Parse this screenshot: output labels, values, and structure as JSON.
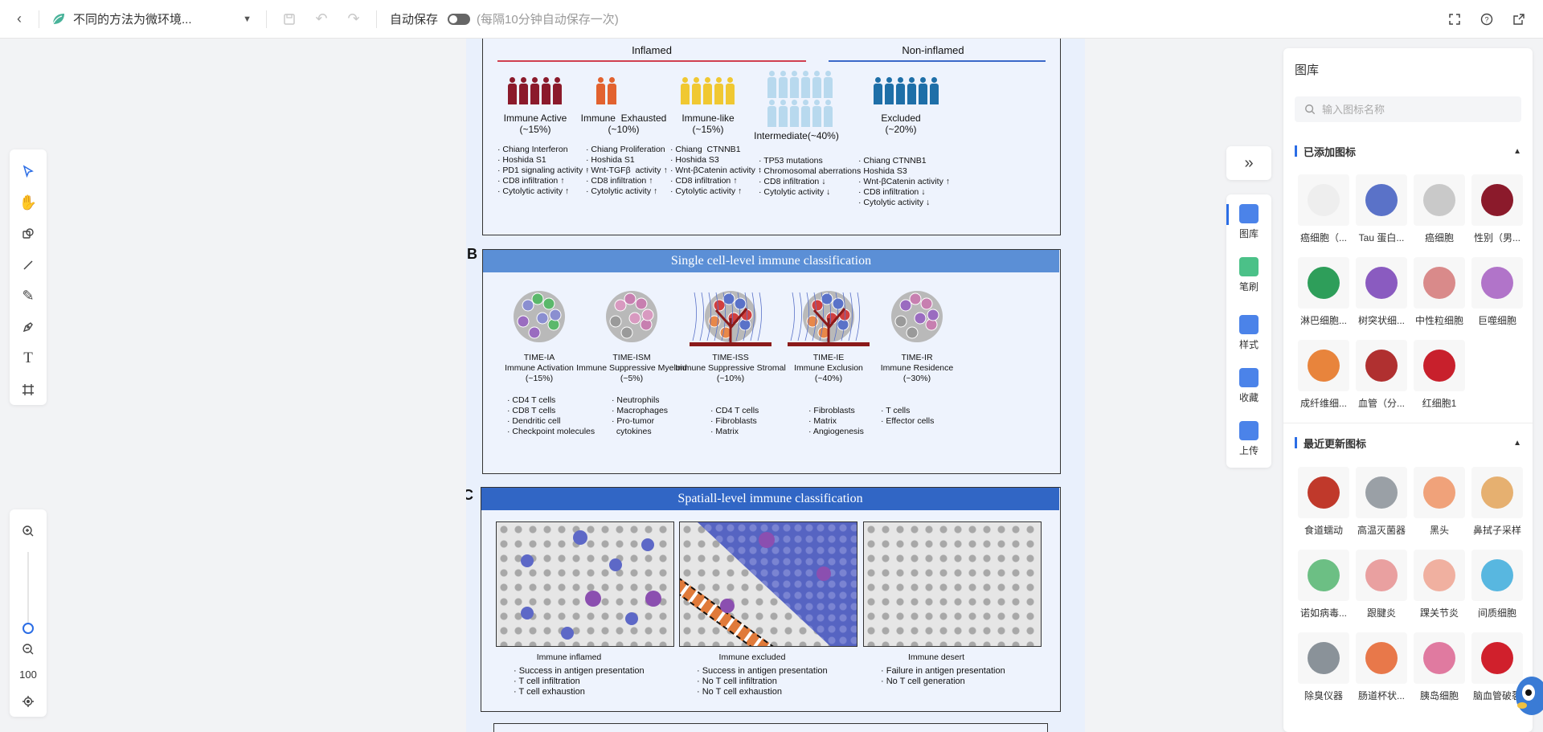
{
  "topbar": {
    "back_icon": "chevron-left-icon",
    "title": "不同的方法为微环境...",
    "autosave_label": "自动保存",
    "autosave_note": "(每隔10分钟自动保存一次)",
    "autosave_enabled": false
  },
  "zoom": {
    "value": "100"
  },
  "figure": {
    "panelA": {
      "inflamed_label": "Inflamed",
      "noninflamed_label": "Non-inflamed",
      "groups": [
        {
          "name": "Immune Active",
          "pct": "(~15%)",
          "color": "#8b1a2b",
          "count": 5,
          "bullets": "· Chiang Interferon\n· Hoshida S1\n· PD1 signaling activity ↑\n· CD8 infiltration ↑\n· Cytolytic activity ↑"
        },
        {
          "name": "Immune  Exhausted",
          "pct": "(~10%)",
          "color": "#e2622f",
          "count": 2,
          "bullets": "· Chiang Proliferation\n· Hoshida S1\n· Wnt-TGFβ  activity ↑\n· CD8 infiltration ↑\n· Cytolytic activity ↑"
        },
        {
          "name": "Immune-like",
          "pct": "(~15%)",
          "color": "#f0c832",
          "count": 5,
          "bullets": "· Chiang  CTNNB1\n· Hoshida S3\n· Wnt-βCatenin activity ↑\n· CD8 infiltration ↑\n· Cytolytic activity ↑"
        },
        {
          "name": "Intermediate(~40%)",
          "pct": "",
          "color": "#b8d9ee",
          "count": 6,
          "bullets": "· TP53 mutations\n· Chromosomal aberrations\n· CD8 infiltration ↓\n· Cytolytic activity ↓"
        },
        {
          "name": "Excluded",
          "pct": "(~20%)",
          "color": "#1e6fa8",
          "count": 6,
          "bullets": "· Chiang CTNNB1\n· Hoshida S3\n· Wnt-βCatenin activity ↑\n· CD8 infiltration ↓\n· Cytolytic activity ↓"
        }
      ]
    },
    "panelB": {
      "letter": "B",
      "title": "Single cell-level immune classification",
      "types": [
        {
          "code": "TIME-IA",
          "name": "Immune Activation",
          "pct": "(~15%)",
          "bullets": "· CD4 T cells\n· CD8 T cells\n· Dendritic cell\n· Checkpoint molecules"
        },
        {
          "code": "TIME-ISM",
          "name": "Immune Suppressive Myeloid",
          "pct": "(~5%)",
          "bullets": "· Neutrophils\n· Macrophages\n· Pro-tumor\n  cytokines"
        },
        {
          "code": "TIME-ISS",
          "name": "Immune Suppressive Stromal",
          "pct": "(~10%)",
          "bullets": "· CD4 T cells\n· Fibroblasts\n· Matrix"
        },
        {
          "code": "TIME-IE",
          "name": "Immune Exclusion",
          "pct": "(~40%)",
          "bullets": "· Fibroblasts\n· Matrix\n· Angiogenesis"
        },
        {
          "code": "TIME-IR",
          "name": "Immune Residence",
          "pct": "(~30%)",
          "bullets": "· T cells\n· Effector cells"
        }
      ]
    },
    "panelC": {
      "letter": "C",
      "title": "Spatiall-level immune classification",
      "types": [
        {
          "name": "Immune inflamed",
          "bullets": "· Success in antigen presentation\n· T cell infiltration\n· T cell exhaustion"
        },
        {
          "name": "Immune excluded",
          "bullets": "· Success in antigen presentation\n· No T cell infiltration\n· No T cell exhaustion"
        },
        {
          "name": "Immune desert",
          "bullets": "· Failure in antigen presentation\n· No T cell generation"
        }
      ]
    }
  },
  "right_tabs": [
    {
      "label": "图库",
      "icon": "gallery-icon",
      "color": "#2b6de5"
    },
    {
      "label": "笔刷",
      "icon": "brush-icon",
      "color": "#2bb673"
    },
    {
      "label": "样式",
      "icon": "style-icon",
      "color": "#2b6de5"
    },
    {
      "label": "收藏",
      "icon": "favorite-icon",
      "color": "#2b6de5"
    },
    {
      "label": "上传",
      "icon": "upload-icon",
      "color": "#2b6de5"
    }
  ],
  "library": {
    "title": "图库",
    "search_placeholder": "输入图标名称",
    "added_title": "已添加图标",
    "added": [
      {
        "label": "癌细胞（...",
        "color": "#eeeeee"
      },
      {
        "label": "Tau 蛋白...",
        "color": "#5a72c8"
      },
      {
        "label": "癌细胞",
        "color": "#c9c9c9"
      },
      {
        "label": "性别（男...",
        "color": "#8b1a2b"
      },
      {
        "label": "淋巴细胞...",
        "color": "#2e9e5a"
      },
      {
        "label": "树突状细...",
        "color": "#8a5bc0"
      },
      {
        "label": "中性粒细胞",
        "color": "#d98a8a"
      },
      {
        "label": "巨噬细胞",
        "color": "#b174c9"
      },
      {
        "label": "成纤维细...",
        "color": "#e8843c"
      },
      {
        "label": "血管（分...",
        "color": "#b03030"
      },
      {
        "label": "红细胞1",
        "color": "#c8202c"
      }
    ],
    "recent_title": "最近更新图标",
    "recent": [
      {
        "label": "食道蠕动",
        "color": "#c0392b"
      },
      {
        "label": "高温灭菌器",
        "color": "#9aa0a6"
      },
      {
        "label": "黑头",
        "color": "#f0a27a"
      },
      {
        "label": "鼻拭子采样",
        "color": "#e6b070"
      },
      {
        "label": "诺如病毒...",
        "color": "#6cbf84"
      },
      {
        "label": "跟腱炎",
        "color": "#e9a0a0"
      },
      {
        "label": "踝关节炎",
        "color": "#f0b0a0"
      },
      {
        "label": "间质细胞",
        "color": "#58b7e0"
      },
      {
        "label": "除臭仪器",
        "color": "#8a9299"
      },
      {
        "label": "肠道杯状...",
        "color": "#e8784a"
      },
      {
        "label": "胰岛细胞",
        "color": "#e07aa0"
      },
      {
        "label": "脑血管破裂",
        "color": "#d0202c"
      }
    ]
  }
}
